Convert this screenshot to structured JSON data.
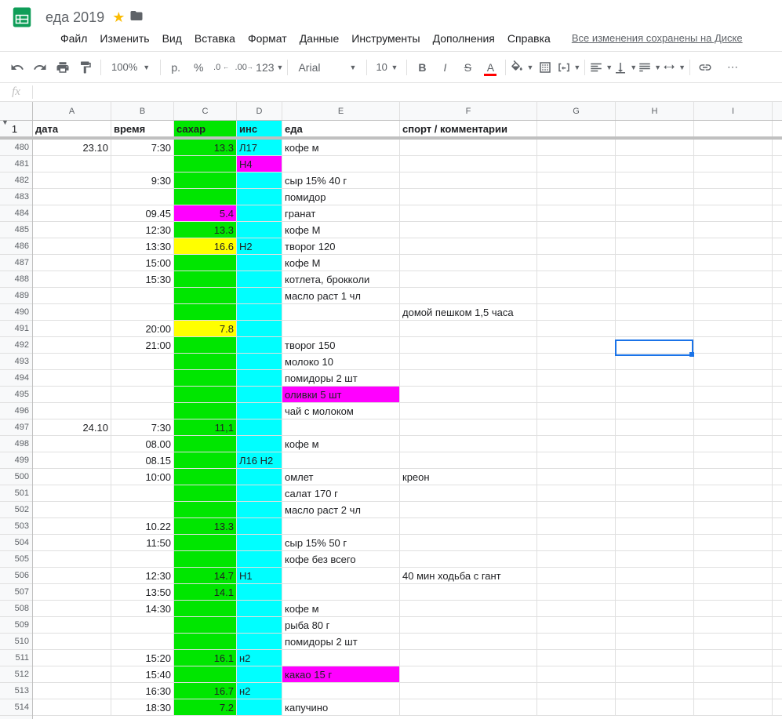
{
  "doc": {
    "title": "еда 2019"
  },
  "saveMessage": "Все изменения сохранены на Диске",
  "menu": [
    "Файл",
    "Изменить",
    "Вид",
    "Вставка",
    "Формат",
    "Данные",
    "Инструменты",
    "Дополнения",
    "Справка"
  ],
  "toolbar": {
    "zoom": "100%",
    "font": "Arial",
    "size": "10",
    "currency": "р.",
    "percent": "%",
    "decDec": ".0",
    "incDec": ".00",
    "numFmt": "123"
  },
  "columns": [
    "A",
    "B",
    "C",
    "D",
    "E",
    "F",
    "G",
    "H",
    "I"
  ],
  "frozenRowNum": "1",
  "headers": {
    "A": "дата",
    "B": "время",
    "C": "сахар",
    "D": "инс",
    "E": "еда",
    "F": "спорт / комментарии"
  },
  "rows": [
    {
      "n": "480",
      "A": "23.10",
      "B": "7:30",
      "C": "13.3",
      "Cc": "green",
      "D": "Л17",
      "Dc": "cyan",
      "E": "кофе м"
    },
    {
      "n": "481",
      "Cc": "green",
      "D": "Н4",
      "Dc": "magenta"
    },
    {
      "n": "482",
      "B": "9:30",
      "Cc": "green",
      "Dc": "cyan",
      "E": "сыр 15% 40 г"
    },
    {
      "n": "483",
      "Cc": "green",
      "Dc": "cyan",
      "E": "помидор"
    },
    {
      "n": "484",
      "B": "09.45",
      "C": "5.4",
      "Cc": "magenta",
      "Dc": "cyan",
      "E": "гранат"
    },
    {
      "n": "485",
      "B": "12:30",
      "C": "13.3",
      "Cc": "green",
      "Dc": "cyan",
      "E": "кофе М"
    },
    {
      "n": "486",
      "B": "13:30",
      "C": "16.6",
      "Cc": "yellow",
      "D": "Н2",
      "Dc": "cyan",
      "E": "творог 120"
    },
    {
      "n": "487",
      "B": "15:00",
      "Cc": "green",
      "Dc": "cyan",
      "E": "кофе М"
    },
    {
      "n": "488",
      "B": "15:30",
      "Cc": "green",
      "Dc": "cyan",
      "E": "котлета, брокколи"
    },
    {
      "n": "489",
      "Cc": "green",
      "Dc": "cyan",
      "E": "масло раст 1 чл"
    },
    {
      "n": "490",
      "Cc": "green",
      "Dc": "cyan",
      "F": "домой пешком 1,5 часа"
    },
    {
      "n": "491",
      "B": "20:00",
      "C": "7.8",
      "Cc": "yellow",
      "Dc": "cyan"
    },
    {
      "n": "492",
      "B": "21:00",
      "Cc": "green",
      "Dc": "cyan",
      "E": "творог 150"
    },
    {
      "n": "493",
      "Cc": "green",
      "Dc": "cyan",
      "E": "молоко 10"
    },
    {
      "n": "494",
      "Cc": "green",
      "Dc": "cyan",
      "E": "помидоры 2 шт"
    },
    {
      "n": "495",
      "Cc": "green",
      "Dc": "cyan",
      "E": "оливки 5 шт",
      "Ec": "magenta"
    },
    {
      "n": "496",
      "Cc": "green",
      "Dc": "cyan",
      "E": "чай с молоком"
    },
    {
      "n": "497",
      "A": "24.10",
      "B": "7:30",
      "C": "11,1",
      "Cc": "green",
      "Dc": "cyan"
    },
    {
      "n": "498",
      "B": "08.00",
      "Cc": "green",
      "Dc": "cyan",
      "E": "кофе м"
    },
    {
      "n": "499",
      "B": "08.15",
      "Cc": "green",
      "D": "Л16 Н2",
      "Dc": "cyan"
    },
    {
      "n": "500",
      "B": "10:00",
      "Cc": "green",
      "Dc": "cyan",
      "E": "омлет",
      "F": "креон"
    },
    {
      "n": "501",
      "Cc": "green",
      "Dc": "cyan",
      "E": "салат 170 г"
    },
    {
      "n": "502",
      "Cc": "green",
      "Dc": "cyan",
      "E": "масло раст 2 чл"
    },
    {
      "n": "503",
      "B": "10.22",
      "C": "13.3",
      "Cc": "green",
      "Dc": "cyan"
    },
    {
      "n": "504",
      "B": "11:50",
      "Cc": "green",
      "Dc": "cyan",
      "E": "сыр 15% 50 г"
    },
    {
      "n": "505",
      "Cc": "green",
      "Dc": "cyan",
      "E": "кофе без всего"
    },
    {
      "n": "506",
      "B": "12:30",
      "C": "14.7",
      "Cc": "green",
      "D": "Н1",
      "Dc": "cyan",
      "F": "40 мин ходьба с гант"
    },
    {
      "n": "507",
      "B": "13:50",
      "C": "14.1",
      "Cc": "green",
      "Dc": "cyan"
    },
    {
      "n": "508",
      "B": "14:30",
      "Cc": "green",
      "Dc": "cyan",
      "E": "кофе м"
    },
    {
      "n": "509",
      "Cc": "green",
      "Dc": "cyan",
      "E": "рыба 80 г"
    },
    {
      "n": "510",
      "Cc": "green",
      "Dc": "cyan",
      "E": "помидоры 2 шт"
    },
    {
      "n": "511",
      "B": "15:20",
      "C": "16.1",
      "Cc": "green",
      "D": "н2",
      "Dc": "cyan"
    },
    {
      "n": "512",
      "B": "15:40",
      "Cc": "green",
      "Dc": "cyan",
      "E": "какао 15 г",
      "Ec": "magenta"
    },
    {
      "n": "513",
      "B": "16:30",
      "C": "16.7",
      "Cc": "green",
      "D": "н2",
      "Dc": "cyan"
    },
    {
      "n": "514",
      "B": "18:30",
      "C": "7.2",
      "Cc": "green",
      "Dc": "cyan",
      "E": "капучино"
    }
  ],
  "selection": {
    "col": "H",
    "rowIdx": 12
  }
}
